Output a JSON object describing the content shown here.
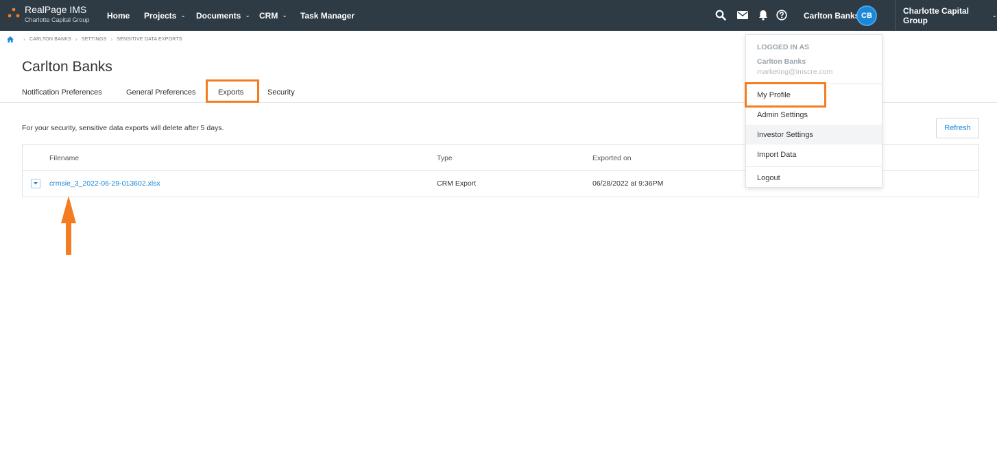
{
  "topbar": {
    "brand_title": "RealPage IMS",
    "brand_subtitle": "Charlotte Capital Group",
    "nav": [
      {
        "label": "Home",
        "has_dropdown": false
      },
      {
        "label": "Projects",
        "has_dropdown": true
      },
      {
        "label": "Documents",
        "has_dropdown": true
      },
      {
        "label": "CRM",
        "has_dropdown": true
      },
      {
        "label": "Task Manager",
        "has_dropdown": false
      }
    ],
    "icons": [
      "search-icon",
      "mail-icon",
      "bell-icon",
      "help-icon"
    ],
    "user_name": "Carlton Banks",
    "avatar_initials": "CB",
    "org_name": "Charlotte Capital Group",
    "bar_color": "#2e3b45",
    "accent": "#1b87d8"
  },
  "breadcrumb": [
    "CARLTON BANKS",
    "SETTINGS",
    "SENSITIVE DATA EXPORTS"
  ],
  "page": {
    "title": "Carlton Banks",
    "tabs": [
      "Notification Preferences",
      "General Preferences",
      "Exports",
      "Security"
    ],
    "active_tab": "Exports",
    "notice": "For your security, sensitive data exports will delete after 5 days.",
    "refresh_label": "Refresh"
  },
  "table": {
    "columns": [
      "Filename",
      "Type",
      "Exported on"
    ],
    "rows": [
      {
        "filename": "crmsie_3_2022-06-29-013602.xlsx",
        "type": "CRM Export",
        "exported_on": "06/28/2022 at 9:36PM"
      }
    ]
  },
  "user_menu": {
    "caption": "LOGGED IN AS",
    "name": "Carlton Banks",
    "email": "marketing@imscre.com",
    "items": [
      "My Profile",
      "Admin Settings",
      "Investor Settings",
      "Import Data"
    ],
    "logout": "Logout"
  },
  "annotation_color": "#f47c20"
}
